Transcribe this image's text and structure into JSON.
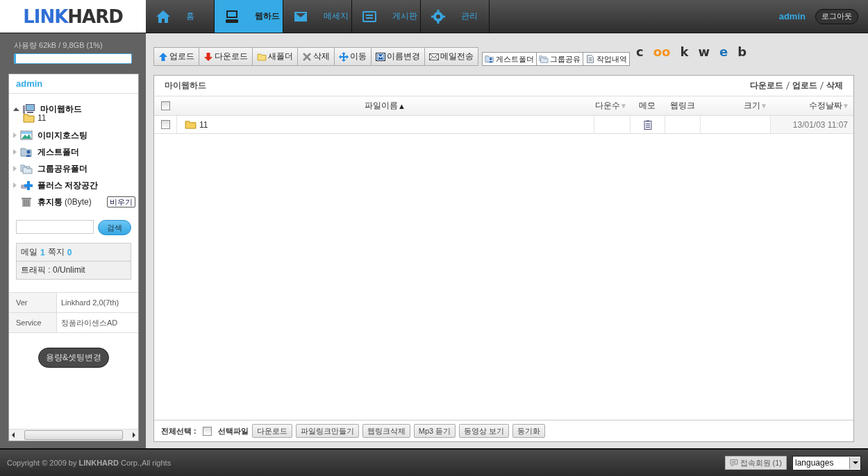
{
  "logo": {
    "first": "LINK",
    "second": "HARD"
  },
  "nav": [
    {
      "label": "홈",
      "kind": "home",
      "selected": false
    },
    {
      "label": "웹하드",
      "kind": "monitor",
      "selected": true
    },
    {
      "label": "메세지",
      "kind": "message",
      "selected": false
    },
    {
      "label": "게시판",
      "kind": "board",
      "selected": false
    },
    {
      "label": "관리",
      "kind": "gear",
      "selected": false
    }
  ],
  "account": {
    "user": "admin",
    "logout": "로그아웃"
  },
  "usage": {
    "text": "사용량 62kB / 9,8GB (1%)",
    "level": 0.01
  },
  "sidebar": {
    "user": "admin",
    "tree": [
      {
        "label": "마이웹하드",
        "kind": "computer",
        "expanded": true,
        "children": [
          {
            "label": "11",
            "kind": "folder"
          }
        ]
      },
      {
        "label": "이미지호스팅",
        "kind": "picture",
        "expanded": false
      },
      {
        "label": "게스트폴더",
        "kind": "guest",
        "expanded": false
      },
      {
        "label": "그룹공유폴더",
        "kind": "group",
        "expanded": false
      },
      {
        "label": "플러스 저장공간",
        "kind": "plus",
        "expanded": false
      }
    ],
    "trash": {
      "label": "휴지통",
      "size": "(0Byte)",
      "button": "비우기"
    },
    "search": {
      "button": "검색"
    },
    "messages": {
      "mail_label": "메일",
      "mail": "1",
      "note_label": "쪽지",
      "note": "0"
    },
    "traffic": "트래픽 : 0/Unlimit",
    "info": [
      {
        "label": "Ver",
        "value": "Linkhard 2,0(7th)"
      },
      {
        "label": "Service",
        "value": "정품라이센스AD"
      }
    ],
    "settings_button": "용량&셋팅변경"
  },
  "toolbar": [
    {
      "label": "업로드",
      "kind": "up"
    },
    {
      "label": "다운로드",
      "kind": "down"
    },
    {
      "label": "새폴더",
      "kind": "folder"
    },
    {
      "label": "삭제",
      "kind": "x"
    },
    {
      "label": "이동",
      "kind": "move"
    },
    {
      "label": "이름변경",
      "kind": "m"
    },
    {
      "label": "메일전송",
      "kind": "mail"
    }
  ],
  "toolbar2": [
    {
      "label": "게스트폴더",
      "kind": "guest"
    },
    {
      "label": "그룹공유",
      "kind": "group"
    },
    {
      "label": "작업내역",
      "kind": "doc"
    }
  ],
  "share": [
    {
      "text": "c",
      "color": "#333333"
    },
    {
      "text": "oo",
      "color": "#f7941d"
    },
    {
      "text": "k",
      "color": "#333333"
    },
    {
      "text": "w",
      "color": "#333333"
    },
    {
      "text": "e",
      "color": "#1b75bc"
    },
    {
      "text": "b",
      "color": "#333333"
    }
  ],
  "panel": {
    "title": "마이웹하드",
    "actions": [
      "다운로드",
      "업로드",
      "삭제"
    ],
    "select_all": false,
    "columns": [
      {
        "label": "파일이름",
        "sort": "▲",
        "sorted": true
      },
      {
        "label": "다운수",
        "sort": "▼",
        "sorted": false
      },
      {
        "label": "메모"
      },
      {
        "label": "웹링크"
      },
      {
        "label": "크기",
        "sort": "▼",
        "sorted": false
      },
      {
        "label": "수정날짜",
        "sort": "▼",
        "sorted": false
      }
    ],
    "rows": [
      {
        "name": "11",
        "kind": "folder",
        "checked": false,
        "memo": true,
        "modified": "13/01/03 11:07"
      }
    ],
    "bottom": {
      "select_all_label": "전체선택 :",
      "select_all": false,
      "selected_label": "선택파일",
      "buttons": [
        "다운로드",
        "파일링크만들기",
        "웹링크삭제",
        "Mp3 듣기",
        "동영상 보기",
        "동기화"
      ]
    }
  },
  "footer": {
    "copyright": "Copyright © 2009 by **LINKHARD** Corp.,All rights",
    "online": "접속회원 (1)",
    "language": "languages"
  }
}
